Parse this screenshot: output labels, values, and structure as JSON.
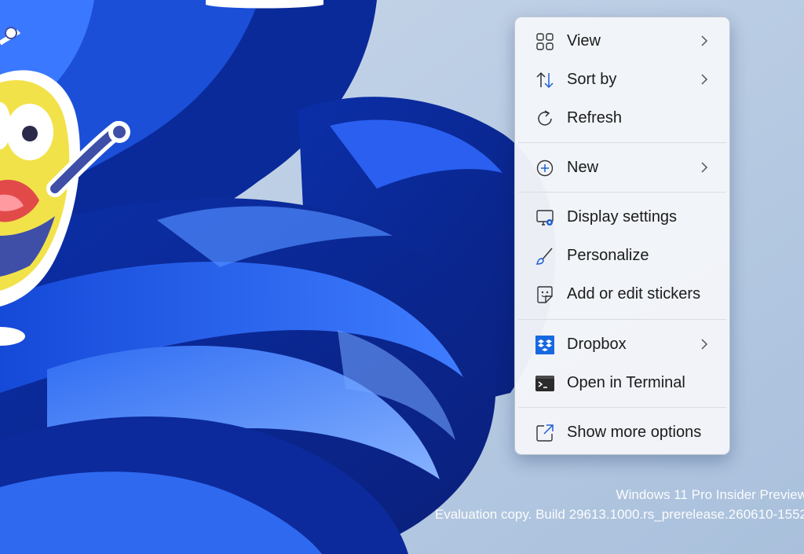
{
  "context_menu": {
    "items": [
      {
        "id": "view",
        "label": "View",
        "icon": "grid-icon",
        "submenu": true
      },
      {
        "id": "sort-by",
        "label": "Sort by",
        "icon": "sort-arrows-icon",
        "submenu": true
      },
      {
        "id": "refresh",
        "label": "Refresh",
        "icon": "refresh-icon",
        "submenu": false
      },
      {
        "id": "new",
        "label": "New",
        "icon": "plus-circle-icon",
        "submenu": true
      },
      {
        "id": "display-settings",
        "label": "Display settings",
        "icon": "display-settings-icon",
        "submenu": false
      },
      {
        "id": "personalize",
        "label": "Personalize",
        "icon": "brush-icon",
        "submenu": false
      },
      {
        "id": "add-edit-stickers",
        "label": "Add or edit stickers",
        "icon": "sticker-icon",
        "submenu": false
      },
      {
        "id": "dropbox",
        "label": "Dropbox",
        "icon": "dropbox-icon",
        "submenu": true
      },
      {
        "id": "open-terminal",
        "label": "Open in Terminal",
        "icon": "terminal-icon",
        "submenu": false
      },
      {
        "id": "show-more-options",
        "label": "Show more options",
        "icon": "share-out-icon",
        "submenu": false
      }
    ]
  },
  "watermark": {
    "line1": "Windows 11 Pro Insider Preview",
    "line2": "Evaluation copy. Build 29613.1000.rs_prerelease.260610-1552"
  },
  "colors": {
    "accent": "#1f5fd0",
    "dropbox": "#1769e0",
    "menu_background": "#f3f5f9"
  }
}
